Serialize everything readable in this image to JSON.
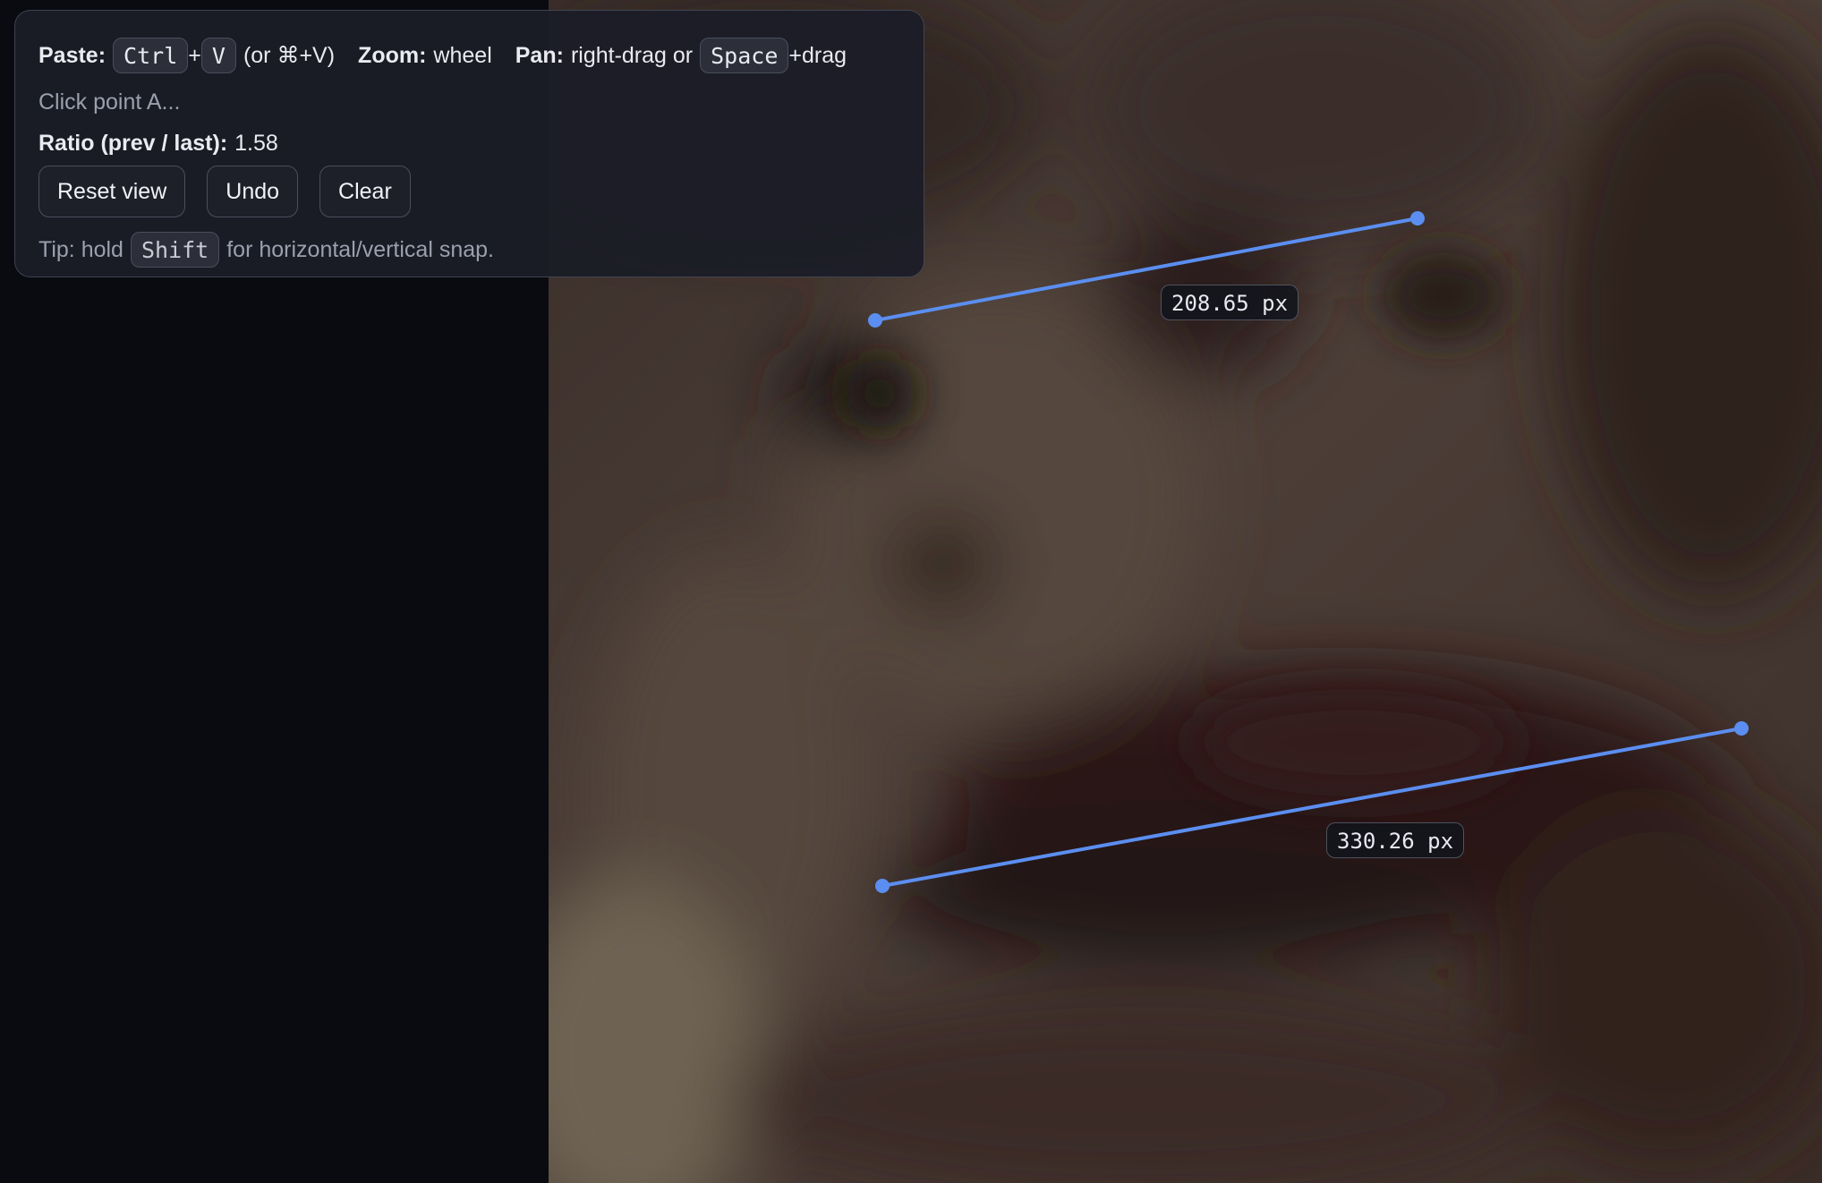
{
  "help": {
    "paste_label": "Paste:",
    "paste_key1": "Ctrl",
    "paste_plus": "+",
    "paste_key2": "V",
    "paste_alt": "(or ⌘+V)",
    "zoom_label": "Zoom:",
    "zoom_value": "wheel",
    "pan_label": "Pan:",
    "pan_value": "right-drag or",
    "pan_key": "Space",
    "pan_suffix": "+drag"
  },
  "status": {
    "prompt": "Click point A..."
  },
  "ratio": {
    "label": "Ratio (prev / last):",
    "value": "1.58"
  },
  "buttons": {
    "reset_view": "Reset view",
    "undo": "Undo",
    "clear": "Clear"
  },
  "tip": {
    "prefix": "Tip: hold",
    "key": "Shift",
    "suffix": "for horizontal/vertical snap."
  },
  "measurements": [
    {
      "label": "208.65 px"
    },
    {
      "label": "330.26 px"
    }
  ],
  "colors": {
    "measure_line": "#5b8ef0",
    "panel_bg": "#1b1d26",
    "canvas_bg": "#090b10"
  }
}
